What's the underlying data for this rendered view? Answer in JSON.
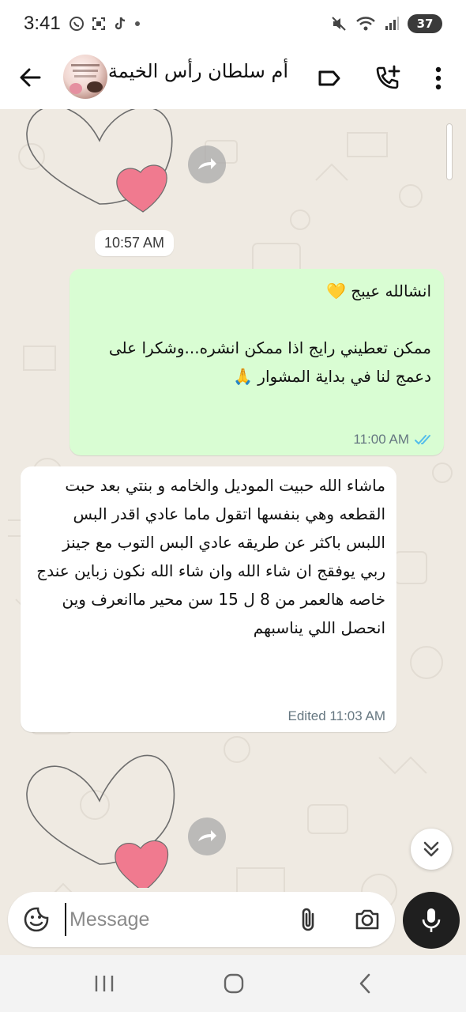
{
  "status_bar": {
    "time": "3:41",
    "battery": "37"
  },
  "header": {
    "title": "أم سلطان رأس الخيمة"
  },
  "messages": [
    {
      "type": "sticker",
      "direction": "incoming",
      "time": "10:57 AM"
    },
    {
      "type": "text",
      "direction": "outgoing",
      "text": "انشالله عيبج 💛\n\nممكن تعطيني رايج اذا ممكن انشره...وشكرا على دعمج لنا في بداية المشوار 🙏",
      "time": "11:00 AM",
      "status": "read"
    },
    {
      "type": "text",
      "direction": "incoming",
      "text": "ماشاء الله حبيت الموديل والخامه و بنتي بعد حبت القطعه وهي بنفسها اتقول ماما عادي اقدر البس اللبس باكثر عن طريقه عادي البس التوب مع جينز ربي يوفقج ان شاء الله وان شاء الله نكون زباين عندج\nخاصه هالعمر من 8 ل 15 سن محير ماانعرف وين انحصل اللي يناسبهم",
      "time": "Edited 11:03 AM"
    },
    {
      "type": "sticker",
      "direction": "incoming"
    }
  ],
  "input": {
    "placeholder": "Message",
    "value": ""
  },
  "colors": {
    "outgoing_bubble": "#d9fdd3",
    "incoming_bubble": "#ffffff",
    "chat_background": "#efeae2",
    "read_ticks": "#53bdeb"
  }
}
